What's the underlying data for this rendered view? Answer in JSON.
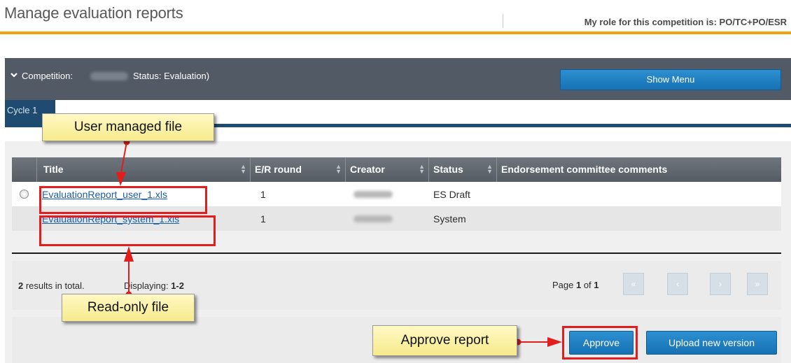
{
  "header": {
    "title": "Manage evaluation reports",
    "role_text": "My role for this competition is: PO/TC+PO/ESR"
  },
  "competition": {
    "label": "Competition:",
    "status": "Status: Evaluation)",
    "show_menu_label": "Show Menu"
  },
  "tabs": [
    {
      "label": "Cycle 1"
    }
  ],
  "table": {
    "columns": [
      "Title",
      "E/R round",
      "Creator",
      "Status",
      "Endorsement committee comments"
    ],
    "rows": [
      {
        "title": "EvaluationReport_user_1.xls",
        "round": "1",
        "status": "ES Draft"
      },
      {
        "title": "EvaluationReport_system_1.xls",
        "round": "1",
        "status": "System"
      }
    ]
  },
  "summary": {
    "count_number": "2",
    "count_suffix": " results in total.",
    "displaying_label": "Displaying: ",
    "displaying_value": "1-2",
    "page_label": "Page ",
    "page_current": "1",
    "page_of": " of ",
    "page_total": "1"
  },
  "pagination": {
    "first": "«",
    "prev": "‹",
    "next": "›",
    "last": "»"
  },
  "actions": {
    "approve_label": "Approve",
    "upload_label": "Upload new version"
  },
  "annotations": {
    "user_managed": "User managed file",
    "read_only": "Read-only file",
    "approve_report": "Approve report"
  },
  "colors": {
    "accent_orange": "#f0a30a",
    "competition_bar": "#525a66",
    "button_blue": "#1672b4",
    "annotation_red": "#e11d1d",
    "callout_yellow": "#fff9c4"
  }
}
